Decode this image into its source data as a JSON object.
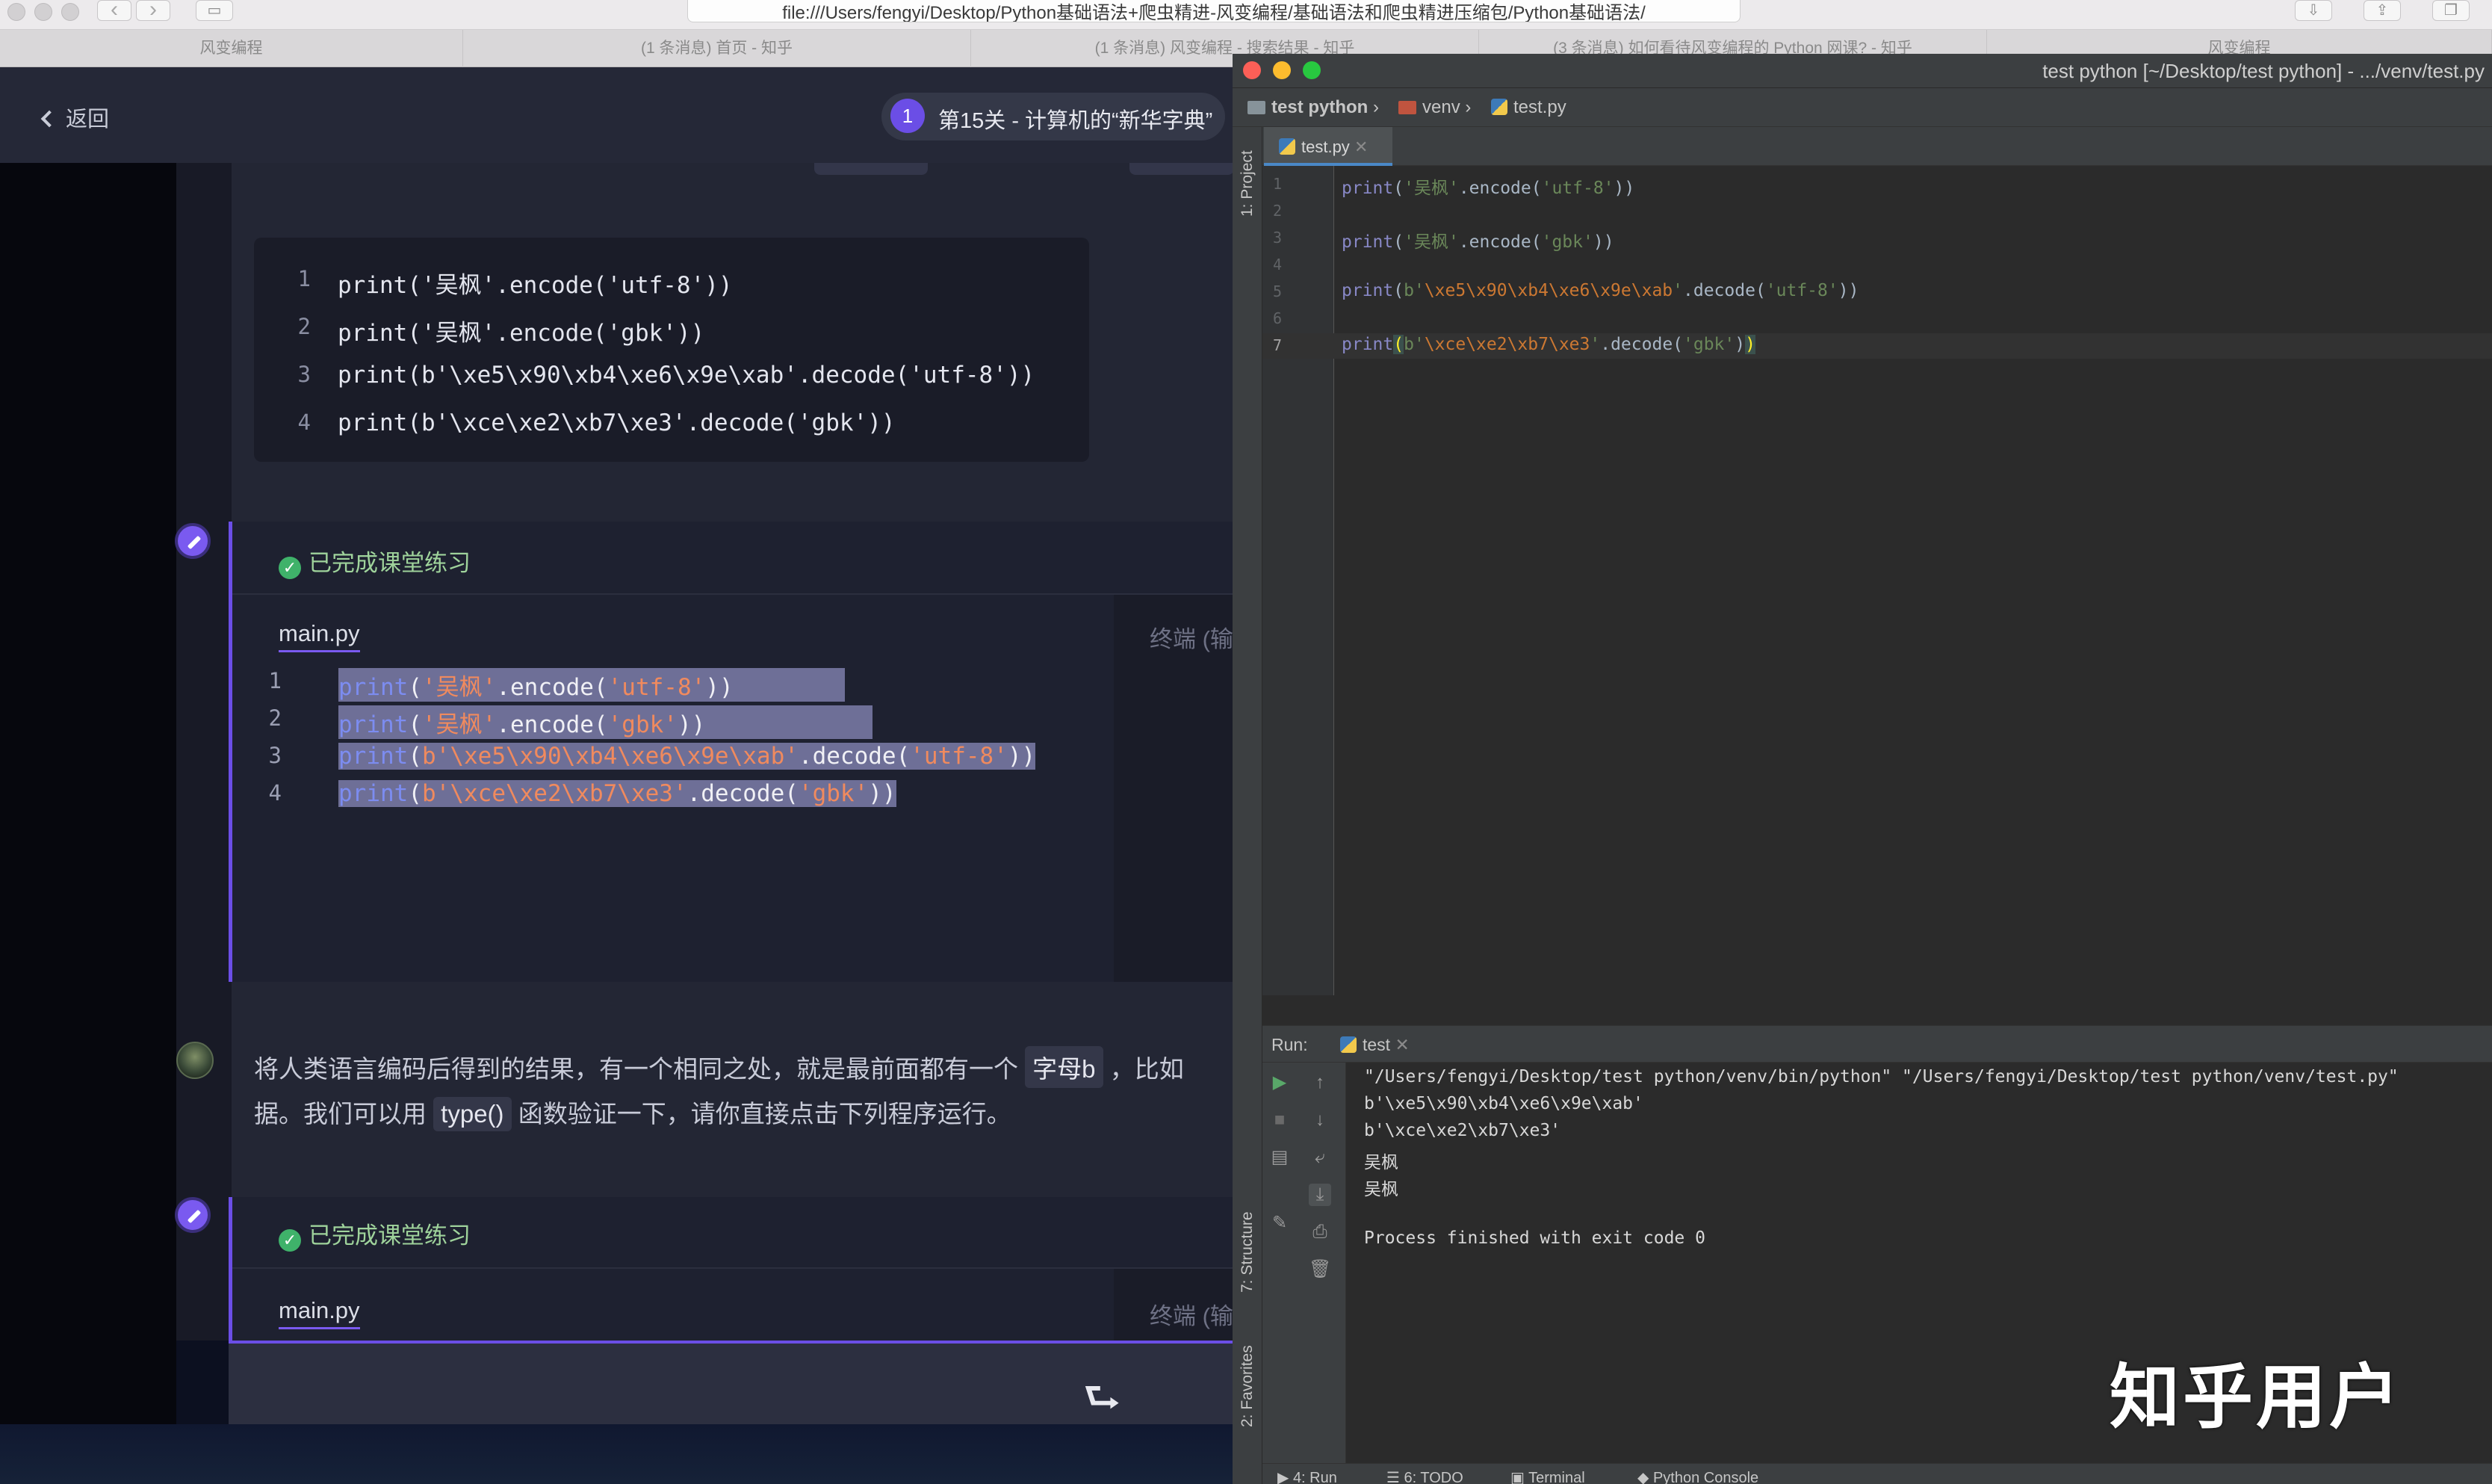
{
  "browser": {
    "address": "file:///Users/fengyi/Desktop/Python基础语法+爬虫精进-风变编程/基础语法和爬虫精进压缩包/Python基础语法/",
    "tabs": [
      "风变编程",
      "(1 条消息) 首页 - 知乎",
      "(1 条消息) 风变编程 - 搜索结果 - 知乎",
      "(3 条消息) 如何看待风变编程的 Python 网课? - 知乎",
      "风变编程"
    ]
  },
  "lesson": {
    "back_label": "返回",
    "level_number": "1",
    "level_title": "第15关 - 计算机的“新华字典”",
    "code_lines": [
      "print('吴枫'.encode('utf-8'))",
      "print('吴枫'.encode('gbk'))",
      "print(b'\\xe5\\x90\\xb4\\xe6\\x9e\\xab'.decode('utf-8'))",
      "print(b'\\xce\\xe2\\xb7\\xe3'.decode('gbk'))"
    ],
    "line_numbers": [
      "1",
      "2",
      "3",
      "4"
    ],
    "exercise_1": {
      "status": "已完成课堂练习",
      "file_tab": "main.py",
      "terminal_label": "终端 (输"
    },
    "paragraph": {
      "line1_before": "将人类语言编码后得到的结果，有一个相同之处，就是最前面都有一个",
      "line1_code": "字母b",
      "line1_after": "，比如",
      "line2_before": "据。我们可以用",
      "line2_code": "type()",
      "line2_after": "函数验证一下，请你直接点击下列程序运行。"
    },
    "exercise_2": {
      "status": "已完成课堂练习",
      "file_tab": "main.py",
      "terminal_label": "终端 (输"
    },
    "enter_icon": "⮑"
  },
  "ide": {
    "title": "test python [~/Desktop/test python] - .../venv/test.py",
    "breadcrumb": {
      "project": "test python",
      "folder": "venv",
      "file": "test.py"
    },
    "editor_tab": "test.py",
    "side_labels": {
      "project": "1: Project",
      "structure": "7: Structure",
      "favorites": "2: Favorites"
    },
    "gutter_numbers": [
      "1",
      "2",
      "3",
      "4",
      "5",
      "6",
      "7"
    ],
    "run_label": "Run:",
    "run_config": "test",
    "console": [
      "\"/Users/fengyi/Desktop/test python/venv/bin/python\" \"/Users/fengyi/Desktop/test python/venv/test.py\"",
      "b'\\xe5\\x90\\xb4\\xe6\\x9e\\xab'",
      "b'\\xce\\xe2\\xb7\\xe3'",
      "吴枫",
      "吴枫",
      "",
      "Process finished with exit code 0"
    ],
    "bottom_tools": [
      "4: Run",
      "6: TODO",
      "Terminal",
      "Python Console"
    ]
  },
  "watermark": "知乎用户"
}
